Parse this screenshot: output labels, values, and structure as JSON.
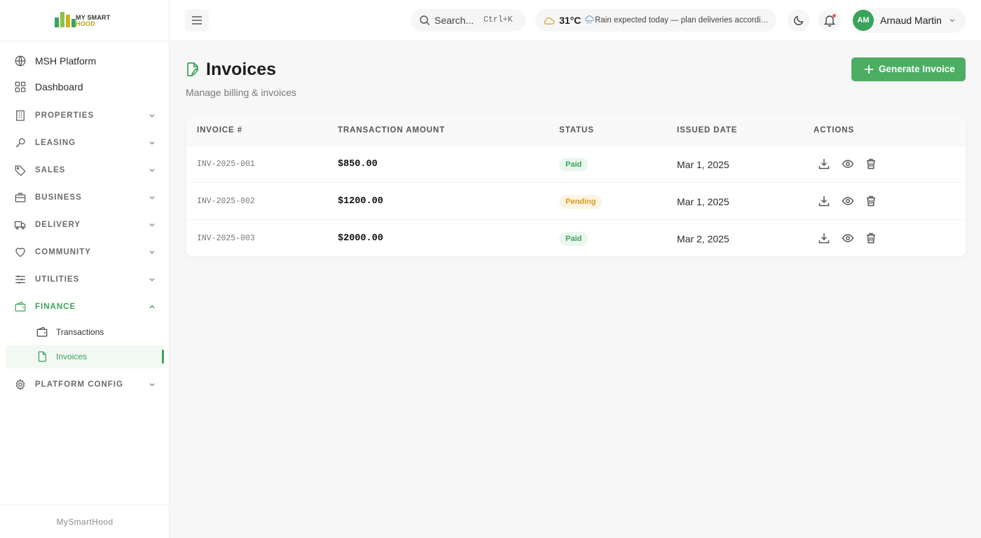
{
  "brand": {
    "logo_line1": "MY SMART",
    "logo_line2": "HOOD",
    "footer": "MySmartHood"
  },
  "sidebar": {
    "top_items": [
      {
        "label": "MSH Platform",
        "icon": "globe-icon"
      },
      {
        "label": "Dashboard",
        "icon": "grid-icon"
      }
    ],
    "sections": [
      {
        "label": "PROPERTIES",
        "icon": "building-icon"
      },
      {
        "label": "LEASING",
        "icon": "key-icon"
      },
      {
        "label": "SALES",
        "icon": "tag-icon"
      },
      {
        "label": "BUSINESS",
        "icon": "briefcase-icon"
      },
      {
        "label": "DELIVERY",
        "icon": "truck-icon"
      },
      {
        "label": "COMMUNITY",
        "icon": "heart-icon"
      },
      {
        "label": "UTILITIES",
        "icon": "sliders-icon"
      },
      {
        "label": "FINANCE",
        "icon": "wallet-icon",
        "expanded": true
      },
      {
        "label": "PLATFORM CONFIG",
        "icon": "gear-icon"
      }
    ],
    "finance_items": [
      {
        "label": "Transactions",
        "icon": "wallet-icon"
      },
      {
        "label": "Invoices",
        "icon": "file-icon",
        "active": true
      }
    ]
  },
  "topbar": {
    "search_placeholder": "Search...",
    "search_shortcut": "Ctrl+K",
    "weather": {
      "temp": "31°C",
      "message": "Rain expected today — plan deliveries accordingly"
    },
    "user": {
      "initials": "AM",
      "name": "Arnaud Martin"
    }
  },
  "page": {
    "title": "Invoices",
    "subtitle": "Manage billing & invoices",
    "generate_label": "Generate Invoice"
  },
  "table": {
    "columns": [
      "INVOICE #",
      "TRANSACTION AMOUNT",
      "STATUS",
      "ISSUED DATE",
      "ACTIONS"
    ],
    "rows": [
      {
        "invoice": "INV-2025-001",
        "amount": "$850.00",
        "status": "Paid",
        "date": "Mar 1, 2025"
      },
      {
        "invoice": "INV-2025-002",
        "amount": "$1200.00",
        "status": "Pending",
        "date": "Mar 1, 2025"
      },
      {
        "invoice": "INV-2025-003",
        "amount": "$2000.00",
        "status": "Paid",
        "date": "Mar 2, 2025"
      }
    ]
  },
  "colors": {
    "accent": "#3aa35a",
    "button": "#4cae63",
    "pending": "#d49a22"
  }
}
